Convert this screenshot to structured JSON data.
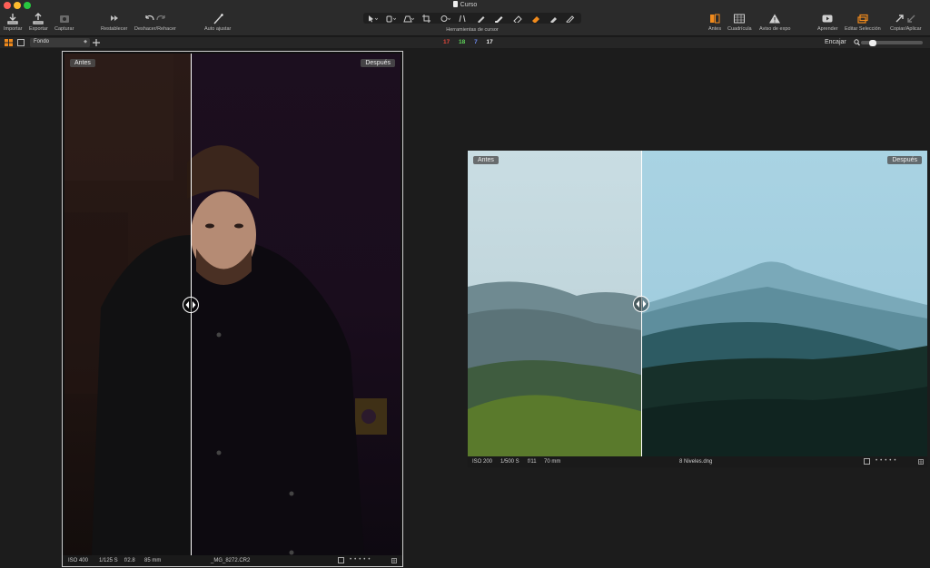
{
  "window": {
    "title": "Curso"
  },
  "toolbar": {
    "importar": "Importar",
    "exportar": "Exportar",
    "capturar": "Capturar",
    "restablecer": "Restablecer",
    "deshacer": "Deshacer/Rehacer",
    "auto": "Auto ajustar",
    "cursor_tools": "Herramientas de cursor",
    "antes": "Antes",
    "cuadricula": "Cuadrícula",
    "aviso": "Aviso de expo",
    "aprender": "Aprender",
    "editar": "Editar Selección",
    "copiar": "Copiar/Aplicar"
  },
  "subbar": {
    "layer": "Fondo",
    "count_red": "17",
    "count_green": "18",
    "count_blue": "7",
    "count_white": "17",
    "fit": "Encajar",
    "zoom_level": 0.15
  },
  "viewer_left": {
    "before": "Antes",
    "after": "Después",
    "iso": "ISO 400",
    "shutter": "1/125 S",
    "aperture": "f/2.8",
    "focal": "85 mm",
    "filename": "_MG_8272.CR2",
    "split": 0.38
  },
  "viewer_right": {
    "before": "Antes",
    "after": "Después",
    "iso": "ISO 200",
    "shutter": "1/500 S",
    "aperture": "f/11",
    "focal": "70 mm",
    "filename": "8 Niveles.dng",
    "split": 0.38
  },
  "colors": {
    "count_red": "#e2473c",
    "count_green": "#5fd35a",
    "count_blue": "#6f8cf2",
    "accent_orange": "#f08a1c"
  }
}
